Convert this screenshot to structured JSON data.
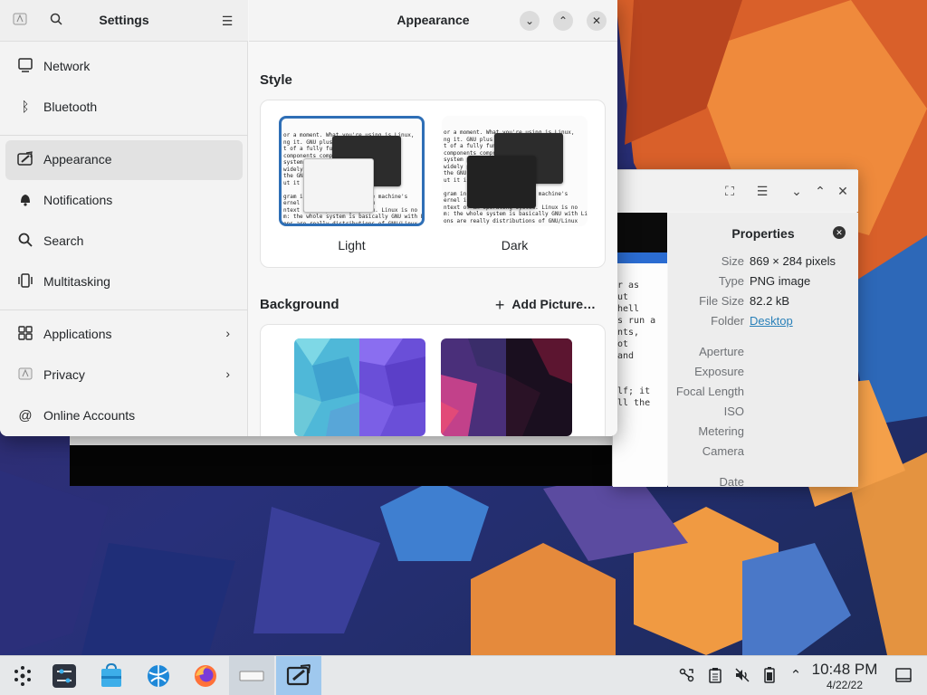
{
  "settings": {
    "sidebar_title": "Settings",
    "page_title": "Appearance",
    "nav": [
      {
        "label": "Network",
        "icon": "network-icon"
      },
      {
        "label": "Bluetooth",
        "icon": "bluetooth-icon"
      },
      {
        "label": "Appearance",
        "icon": "appearance-icon",
        "active": true
      },
      {
        "label": "Notifications",
        "icon": "bell-icon"
      },
      {
        "label": "Search",
        "icon": "search-icon"
      },
      {
        "label": "Multitasking",
        "icon": "multitasking-icon"
      },
      {
        "label": "Applications",
        "icon": "apps-grid-icon"
      },
      {
        "label": "Privacy",
        "icon": "privacy-icon"
      },
      {
        "label": "Online Accounts",
        "icon": "at-icon"
      }
    ],
    "style_section": "Style",
    "style_options": [
      {
        "label": "Light",
        "selected": true
      },
      {
        "label": "Dark",
        "selected": false
      }
    ],
    "background_section": "Background",
    "add_picture": "Add Picture…"
  },
  "viewer": {
    "properties_title": "Properties",
    "props": [
      {
        "key": "Size",
        "value": "869 × 284 pixels"
      },
      {
        "key": "Type",
        "value": "PNG image"
      },
      {
        "key": "File Size",
        "value": "82.2 kB"
      },
      {
        "key": "Folder",
        "value": "Desktop",
        "link": true
      },
      {
        "key": "Aperture",
        "value": ""
      },
      {
        "key": "Exposure",
        "value": ""
      },
      {
        "key": "Focal Length",
        "value": ""
      },
      {
        "key": "ISO",
        "value": ""
      },
      {
        "key": "Metering",
        "value": ""
      },
      {
        "key": "Camera",
        "value": ""
      },
      {
        "key": "Date",
        "value": ""
      }
    ]
  },
  "taskbar": {
    "time": "10:48 PM",
    "date": "4/22/22"
  },
  "colors": {
    "accent": "#2f6fb6",
    "taskbar_focused": "#9fc8ee",
    "link": "#2980b9"
  }
}
